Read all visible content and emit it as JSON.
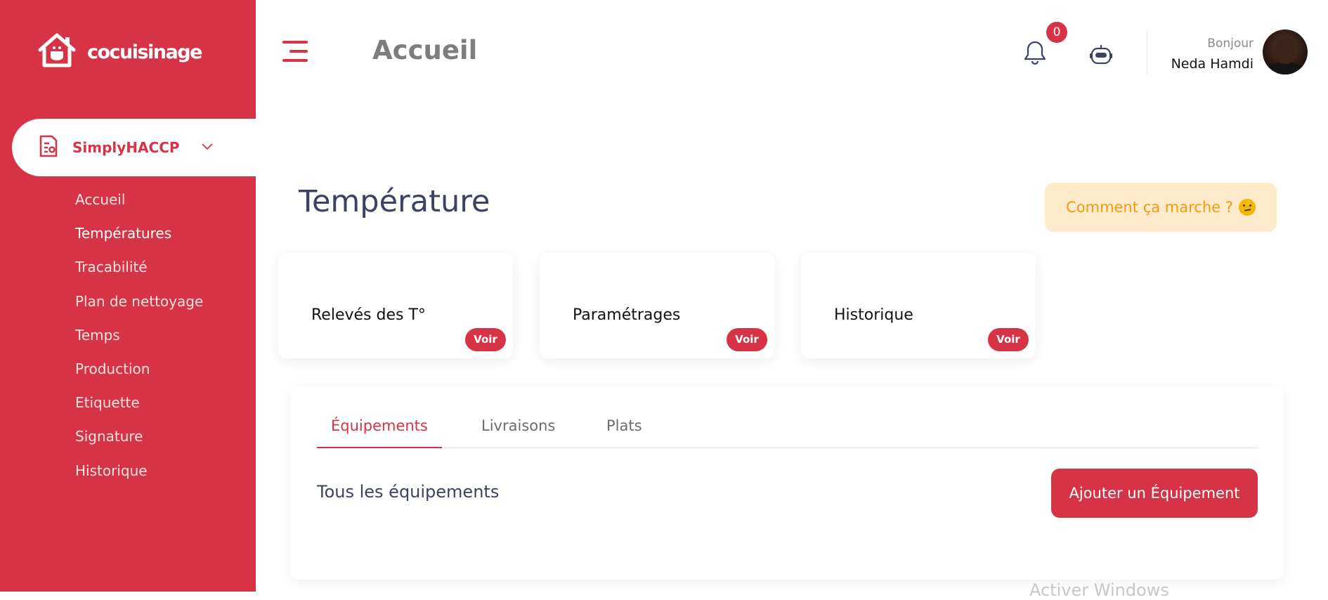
{
  "brand": {
    "name": "cocuisinage",
    "primary_color": "#d63347"
  },
  "sidebar": {
    "module_label": "SimplyHACCP",
    "items": [
      {
        "label": "Accueil"
      },
      {
        "label": "Températures"
      },
      {
        "label": "Tracabilité"
      },
      {
        "label": "Plan de nettoyage"
      },
      {
        "label": "Temps"
      },
      {
        "label": "Production"
      },
      {
        "label": "Etiquette"
      },
      {
        "label": "Signature"
      },
      {
        "label": "Historique"
      }
    ]
  },
  "header": {
    "title": "Accueil",
    "notification_count": "0",
    "greeting": "Bonjour",
    "user_name": "Neda Hamdi"
  },
  "main": {
    "title": "Température",
    "help_button": "Comment ça marche ?",
    "cards": [
      {
        "label": "Relevés des T°",
        "action": "Voir"
      },
      {
        "label": "Paramétrages",
        "action": "Voir"
      },
      {
        "label": "Historique",
        "action": "Voir"
      }
    ],
    "tabs": [
      {
        "label": "Équipements"
      },
      {
        "label": "Livraisons"
      },
      {
        "label": "Plats"
      }
    ],
    "list_title": "Tous les équipements",
    "add_button": "Ajouter un Équipement"
  },
  "watermark": "Activer Windows"
}
